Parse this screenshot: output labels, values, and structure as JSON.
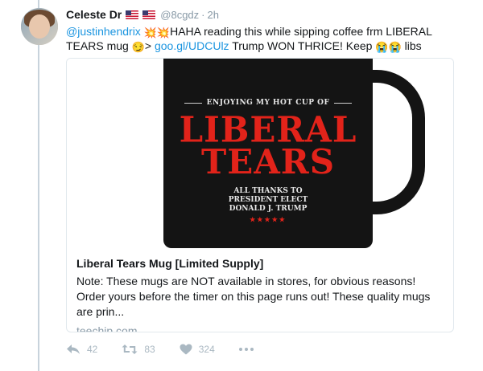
{
  "tweet": {
    "name": "Celeste Dr",
    "flags": [
      "flag-us-icon",
      "flag-us-icon"
    ],
    "handle": "@8cgdz",
    "separator": "·",
    "time": "2h",
    "text": {
      "mention": "@justinhendrix",
      "emoji_1": "💥",
      "emoji_2": "💥",
      "part1": "HAHA reading this while sipping coffee frm LIBERAL TEARS mug ",
      "emoji_3": "😏",
      "part2": "> ",
      "link": "goo.gl/UDCUlz",
      "part3": " Trump WON THRICE! Keep ",
      "emoji_4": "😭",
      "emoji_5": "😭",
      "part4": " libs"
    }
  },
  "card": {
    "image": {
      "top_text": "ENJOYING MY HOT CUP OF",
      "line1": "LIBERAL",
      "line2": "TEARS",
      "thanks_1": "ALL THANKS TO",
      "thanks_2": "PRESIDENT ELECT",
      "thanks_3": "DONALD J. TRUMP",
      "stars": "★★★★★",
      "colors": {
        "mug": "#141414",
        "accent_red": "#e2231a"
      }
    },
    "title": "Liberal Tears Mug [Limited Supply]",
    "description": "Note: These mugs are NOT available in stores, for obvious reasons! Order yours before the timer on this page runs out! These quality mugs are prin...",
    "domain": "teechip.com"
  },
  "actions": {
    "reply": {
      "icon": "reply-icon",
      "count": "42"
    },
    "retweet": {
      "icon": "retweet-icon",
      "count": "83"
    },
    "like": {
      "icon": "heart-icon",
      "count": "324"
    },
    "more": {
      "icon": "more-icon"
    }
  },
  "colors": {
    "link": "#1b95e0",
    "muted": "#8899a6",
    "action": "#aab8c2"
  }
}
